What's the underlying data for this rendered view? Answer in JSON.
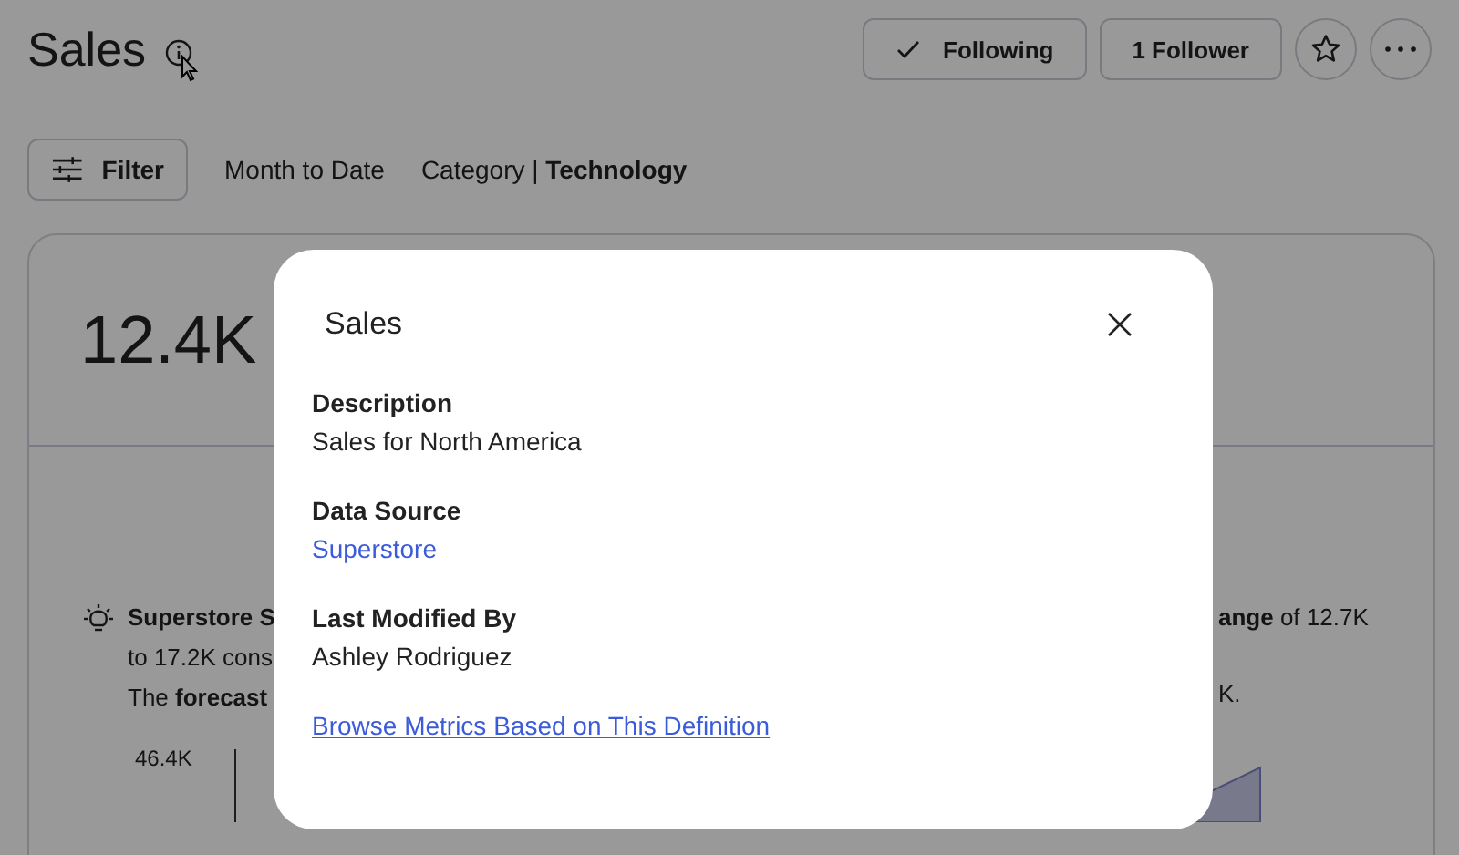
{
  "header": {
    "title": "Sales",
    "buttons": [
      {
        "kind": "check",
        "label": "Following"
      },
      {
        "kind": "plain",
        "label": "1 Follower"
      }
    ]
  },
  "filters": {
    "button": "Filter",
    "period": "Month to Date",
    "category_label": "Category",
    "category_separator": "|",
    "category_value": "Technology"
  },
  "metric": {
    "value": "12.4K"
  },
  "insight": {
    "left_lines": [
      {
        "text": "Superstore S",
        "bold": true
      },
      {
        "text": "to 17.2K cons",
        "bold": false
      },
      {
        "text": "The **forecast**",
        "bold": false
      }
    ],
    "right_lines": [
      "**ange** of 12.7K",
      "K."
    ]
  },
  "chart": {
    "y_label": "46.4K"
  },
  "dialog": {
    "title": "Sales",
    "fields": [
      {
        "label": "Description",
        "value": "Sales for North America",
        "kind": "text"
      },
      {
        "label": "Data Source",
        "value": "Superstore",
        "kind": "link"
      },
      {
        "label": "Last Modified By",
        "value": "Ashley Rodriguez",
        "kind": "text"
      }
    ],
    "link": "Browse Metrics Based on This Definition"
  }
}
